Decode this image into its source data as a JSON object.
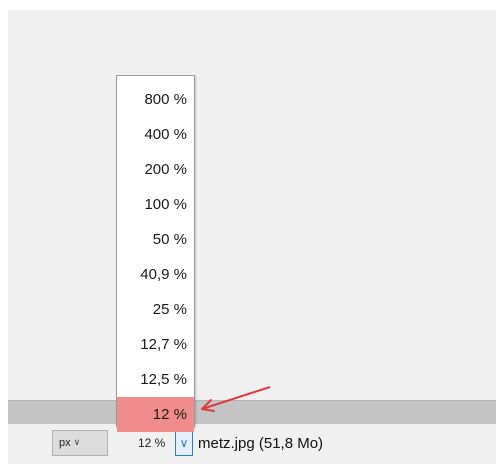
{
  "statusbar": {
    "unit_label": "px",
    "unit_chevron_icon": "chevron-down-icon",
    "zoom_value": "12 %",
    "zoom_dropdown_icon": "chevron-down-icon",
    "file_info": "metz.jpg (51,8 Mo)"
  },
  "zoom_menu": {
    "items": [
      "800 %",
      "400 %",
      "200 %",
      "100 %",
      "50 %",
      "40,9 %",
      "25 %",
      "12,7 %",
      "12,5 %",
      "12 %"
    ],
    "selected": "12 %",
    "selected_color": "#f08c8c"
  },
  "annotation": {
    "arrow_color": "#e23a3a",
    "arrow_icon": "red-arrow-annotation"
  }
}
